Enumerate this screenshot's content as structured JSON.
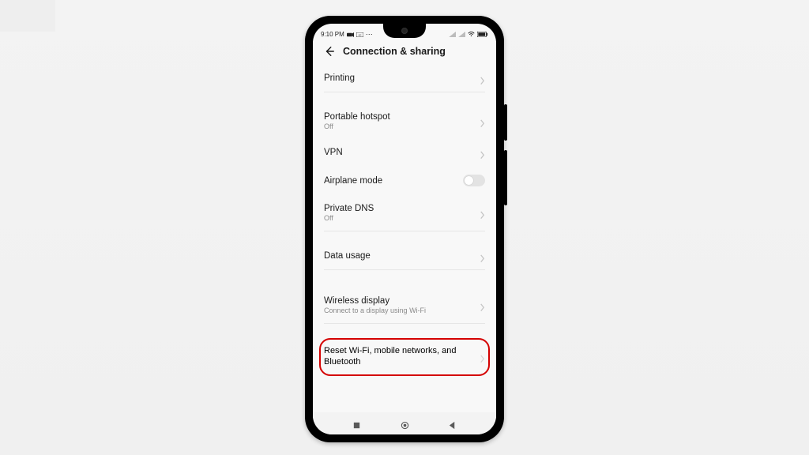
{
  "statusbar": {
    "time": "9:10 PM",
    "icons_left": [
      "record-icon",
      "cc-icon",
      "more-icon"
    ],
    "icons_right": [
      "signal-icon",
      "signal-icon",
      "wifi-icon",
      "battery-icon"
    ]
  },
  "appbar": {
    "title": "Connection & sharing"
  },
  "rows": {
    "printing": {
      "label": "Printing"
    },
    "hotspot": {
      "label": "Portable hotspot",
      "sub": "Off"
    },
    "vpn": {
      "label": "VPN"
    },
    "airplane": {
      "label": "Airplane mode",
      "toggle": "off"
    },
    "dns": {
      "label": "Private DNS",
      "sub": "Off"
    },
    "data": {
      "label": "Data usage"
    },
    "wdisplay": {
      "label": "Wireless display",
      "sub": "Connect to a display using Wi-Fi"
    },
    "reset": {
      "label": "Reset Wi-Fi, mobile networks, and Bluetooth"
    }
  },
  "highlight": "reset"
}
